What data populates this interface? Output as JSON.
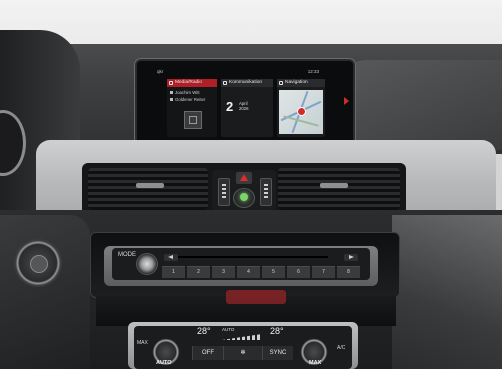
{
  "screen": {
    "status_left": "qkr",
    "status_right": "12:33",
    "tiles": {
      "media": {
        "title": "Media/Radio",
        "items": [
          "Joachim Witt",
          "Goldener Reiter"
        ]
      },
      "communication": {
        "title": "Kommunikation",
        "date_day": "2",
        "date_month": "April",
        "date_year": "2026"
      },
      "navigation": {
        "title": "Navigation"
      }
    }
  },
  "radio": {
    "mode_label": "MODE",
    "preset_keys": [
      "1",
      "2",
      "3",
      "4",
      "5",
      "6",
      "7",
      "8"
    ]
  },
  "climate": {
    "temp_left": "28°",
    "temp_right": "28°",
    "auto_small": "AUTO",
    "left_knob": "AUTO",
    "right_knob": "MAX",
    "max_label": "MAX",
    "ac_label": "A/C",
    "buttons": [
      "OFF",
      "SYNC"
    ]
  },
  "colors": {
    "accent_red": "#b01f26",
    "lock_green": "#7bd36a"
  }
}
